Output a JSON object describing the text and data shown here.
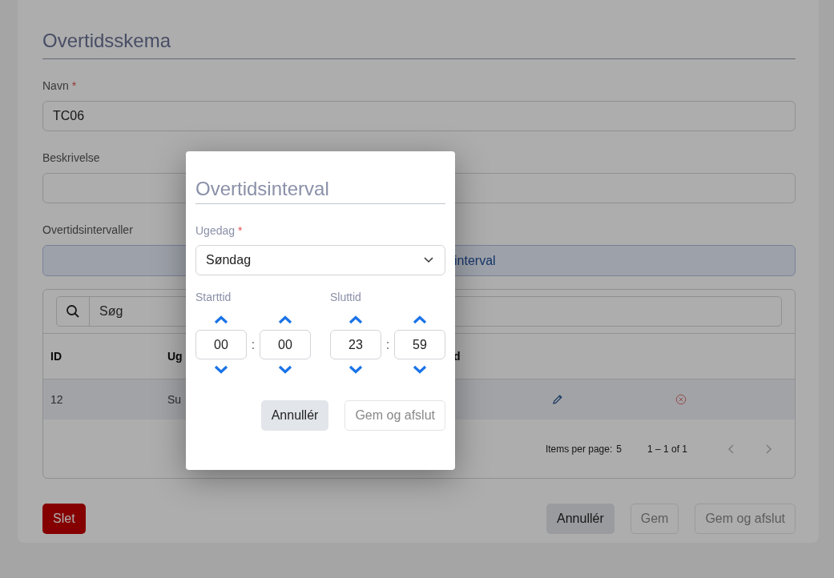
{
  "form": {
    "title": "Overtidsskema",
    "name": {
      "label": "Navn",
      "required_mark": "*",
      "value": "TC06"
    },
    "description": {
      "label": "Beskrivelse"
    },
    "intervals": {
      "label": "Overtidsintervaller",
      "add_button": "interval"
    },
    "table": {
      "search_placeholder": "Søg",
      "columns": [
        "ID",
        "Ug",
        "d"
      ],
      "rows": [
        {
          "cells": [
            "12",
            "Su"
          ]
        }
      ],
      "pagination": {
        "items_per_page_label": "Items per page:",
        "items_per_page": "5",
        "range": "1 – 1 of 1",
        "prev_disabled": true,
        "next_disabled": true
      }
    },
    "actions": [
      {
        "label": "Slet",
        "kind": "danger",
        "disabled": false
      },
      {
        "label": "Annullér",
        "kind": "secondary",
        "disabled": false
      },
      {
        "label": "Gem",
        "kind": "primary",
        "disabled": true
      },
      {
        "label": "Gem og afslut",
        "kind": "primary",
        "disabled": true
      }
    ]
  },
  "dialog": {
    "title": "Overtidsinterval",
    "weekday": {
      "label": "Ugedag",
      "required_mark": "*",
      "value": "Søndag"
    },
    "times": [
      {
        "label": "Starttid",
        "hours": "00",
        "minutes": "00",
        "separator": ":"
      },
      {
        "label": "Sluttid",
        "hours": "23",
        "minutes": "59",
        "separator": ":"
      }
    ],
    "buttons": [
      {
        "label": "Annullér",
        "kind": "secondary",
        "disabled": false
      },
      {
        "label": "Gem og afslut",
        "kind": "primary",
        "disabled": true
      }
    ]
  }
}
